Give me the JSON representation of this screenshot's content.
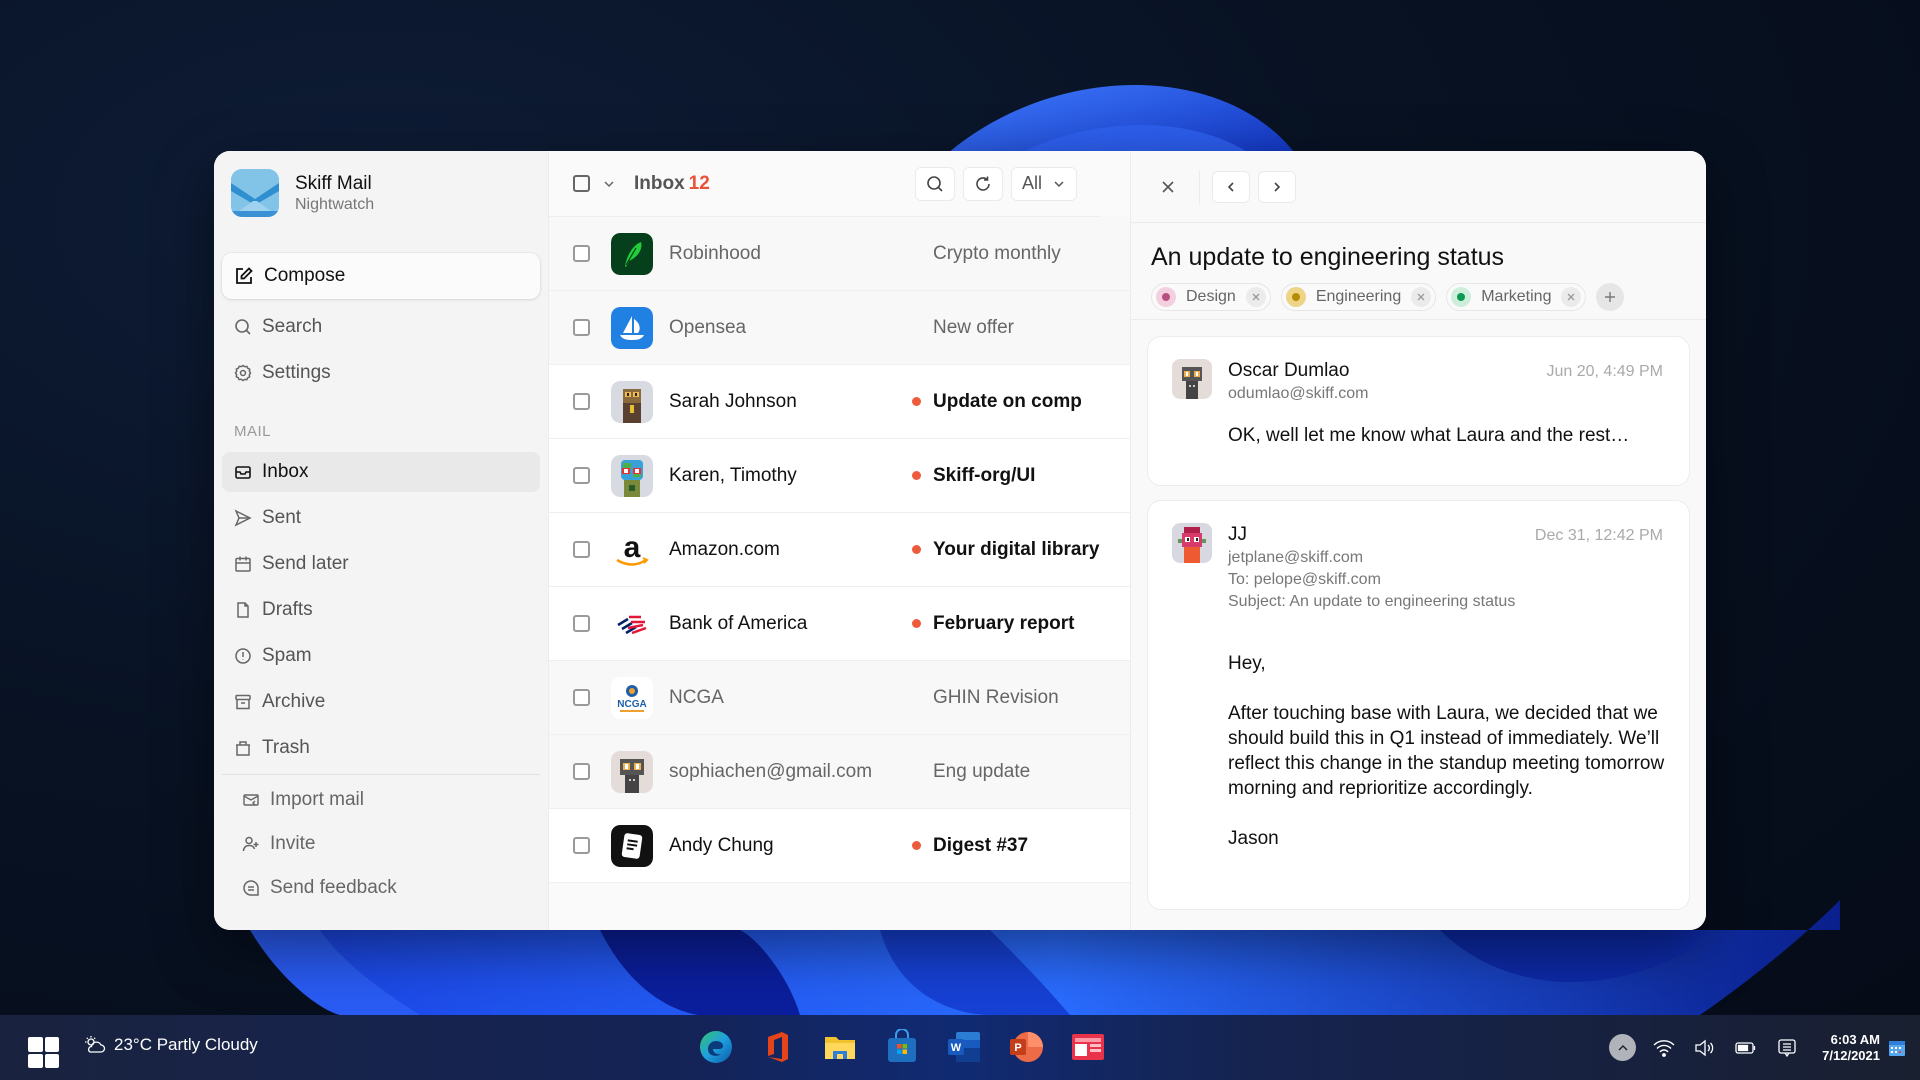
{
  "app": {
    "name": "Skiff Mail",
    "workspace": "Nightwatch"
  },
  "sidebar": {
    "compose_label": "Compose",
    "top_items": [
      {
        "label": "Search",
        "icon": "search-icon"
      },
      {
        "label": "Settings",
        "icon": "gear-icon"
      }
    ],
    "section_label": "MAIL",
    "mail_items": [
      {
        "label": "Inbox",
        "icon": "inbox-icon",
        "active": true
      },
      {
        "label": "Sent",
        "icon": "send-icon"
      },
      {
        "label": "Send later",
        "icon": "calendar-icon"
      },
      {
        "label": "Drafts",
        "icon": "file-icon"
      },
      {
        "label": "Spam",
        "icon": "alert-icon"
      },
      {
        "label": "Archive",
        "icon": "archive-icon"
      },
      {
        "label": "Trash",
        "icon": "trash-icon"
      }
    ],
    "bottom_items": [
      {
        "label": "Import mail",
        "icon": "import-icon"
      },
      {
        "label": "Invite",
        "icon": "add-user-icon"
      },
      {
        "label": "Send feedback",
        "icon": "feedback-icon"
      }
    ]
  },
  "list": {
    "title": "Inbox",
    "unread_count": "12",
    "filter_label": "All",
    "emails": [
      {
        "sender": "Robinhood",
        "subject": "Crypto monthly",
        "unread": false,
        "avatar": "robinhood"
      },
      {
        "sender": "Opensea",
        "subject": "New offer",
        "unread": false,
        "avatar": "opensea"
      },
      {
        "sender": "Sarah Johnson",
        "subject": "Update on comp",
        "unread": true,
        "avatar": "pixel-otter"
      },
      {
        "sender": "Karen, Timothy",
        "subject": "Skiff-org/UI",
        "unread": true,
        "avatar": "pixel-globe"
      },
      {
        "sender": "Amazon.com",
        "subject": "Your digital library",
        "unread": true,
        "avatar": "amazon"
      },
      {
        "sender": "Bank of America",
        "subject": "February report",
        "unread": true,
        "avatar": "bofa"
      },
      {
        "sender": "NCGA",
        "subject": "GHIN Revision",
        "unread": false,
        "avatar": "ncga"
      },
      {
        "sender": "sophiachen@gmail.com",
        "subject": "Eng update",
        "unread": false,
        "avatar": "pixel-robot"
      },
      {
        "sender": "Andy Chung",
        "subject": "Digest #37",
        "unread": true,
        "avatar": "notes"
      }
    ]
  },
  "reader": {
    "title": "An update to engineering status",
    "tags": [
      {
        "label": "Design",
        "color": "#b8507f",
        "bg": "#f4cfe0"
      },
      {
        "label": "Engineering",
        "color": "#b88a08",
        "bg": "#edd486"
      },
      {
        "label": "Marketing",
        "color": "#0a9a52",
        "bg": "#cdeedb"
      }
    ],
    "messages": [
      {
        "name": "Oscar Dumlao",
        "email": "odumlao@skiff.com",
        "date": "Jun 20, 4:49 PM",
        "preview": "OK, well let me know what Laura and the rest…"
      },
      {
        "name": "JJ",
        "email": "jetplane@skiff.com",
        "to": "To: pelope@skiff.com",
        "subject": "Subject: An update to engineering status",
        "date": "Dec 31, 12:42 PM",
        "greeting": "Hey,",
        "body": "After touching base with Laura, we decided that we should build this in Q1 instead of immediately. We’ll reflect this change in the standup meeting tomorrow morning and reprioritize accordingly.",
        "signature": "Jason"
      }
    ]
  },
  "taskbar": {
    "weather": "23°C Partly Cloudy",
    "apps": [
      "Microsoft Edge",
      "Office",
      "File Explorer",
      "Microsoft Store",
      "Word",
      "PowerPoint",
      "News"
    ],
    "time": "6:03 AM",
    "date": "7/12/2021"
  }
}
